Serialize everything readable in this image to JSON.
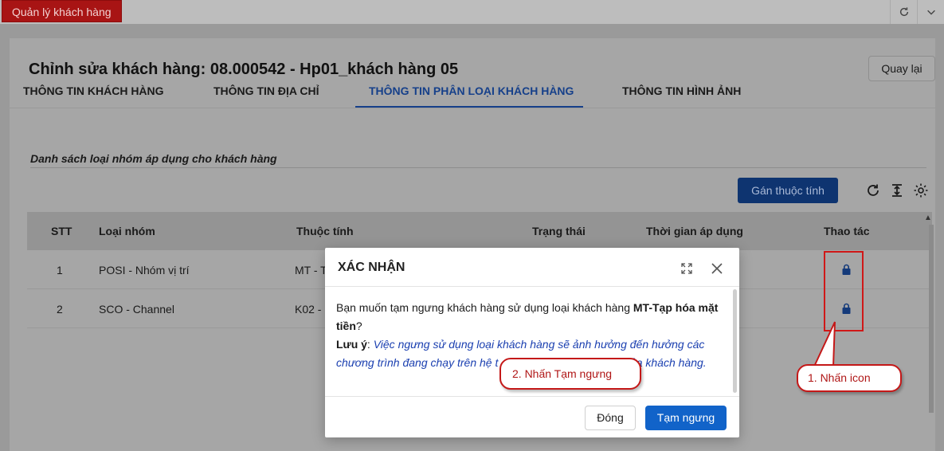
{
  "app": {
    "tab_label": "Quản lý khách hàng"
  },
  "page": {
    "title": "Chỉnh sửa khách hàng: 08.000542 - Hp01_khách hàng 05",
    "back_label": "Quay lại"
  },
  "tabs": [
    {
      "label": "THÔNG TIN KHÁCH HÀNG",
      "active": false
    },
    {
      "label": "THÔNG TIN ĐỊA CHỈ",
      "active": false
    },
    {
      "label": "THÔNG TIN PHÂN LOẠI KHÁCH HÀNG",
      "active": true
    },
    {
      "label": "THÔNG TIN HÌNH ẢNH",
      "active": false
    }
  ],
  "section": {
    "title": "Danh sách loại nhóm áp dụng cho khách hàng",
    "assign_label": "Gán thuộc tính"
  },
  "table": {
    "headers": [
      "STT",
      "Loại nhóm",
      "Thuộc tính",
      "Trạng thái",
      "Thời gian áp dụng",
      "Thao tác"
    ],
    "rows": [
      {
        "stt": "1",
        "group": "POSI - Nhóm vị trí",
        "attr": "MT - T"
      },
      {
        "stt": "2",
        "group": "SCO - Channel",
        "attr": "K02 -"
      }
    ]
  },
  "modal": {
    "title": "XÁC NHẬN",
    "question_prefix": "Bạn muốn tạm ngưng khách hàng sử dụng loại khách hàng ",
    "question_bold": "MT-Tạp hóa mặt tiền",
    "question_suffix": "?",
    "note_label": "Lưu ý",
    "note_sep": ": ",
    "note_text_1": "Việc ngưng sử dụng loại khách hàng sẽ ảnh hưởng đến hưởng các chương trình đang chạy trên hệ t",
    "note_text_2": ") của khách hàng.",
    "close_label": "Đóng",
    "suspend_label": "Tạm ngưng"
  },
  "annotations": {
    "step1": "1. Nhấn icon",
    "step2": "2. Nhấn Tạm ngưng"
  },
  "colors": {
    "app_tab": "#a81414",
    "primary": "#1163c9",
    "annotation": "#d01818"
  }
}
